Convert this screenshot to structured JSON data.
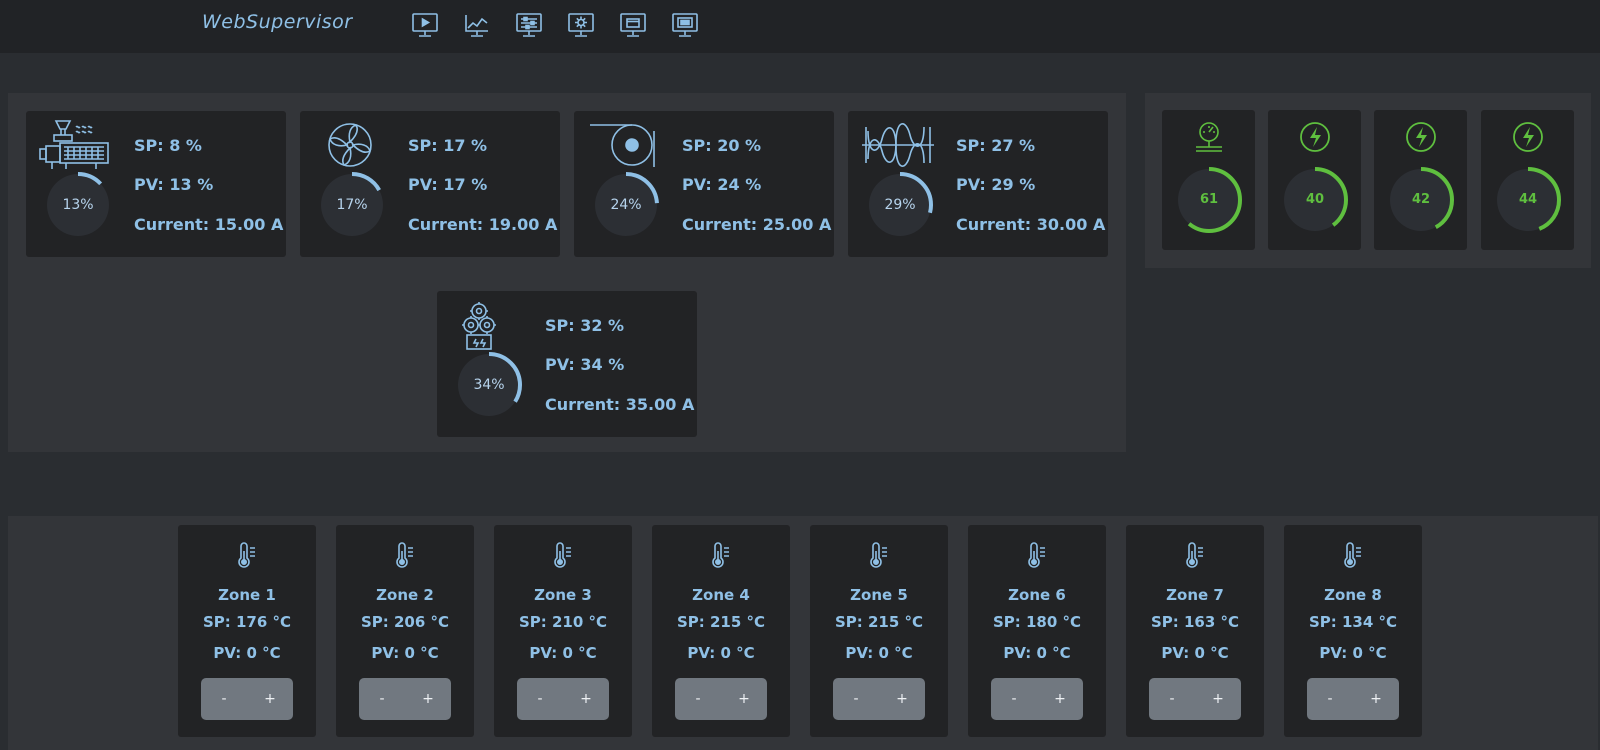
{
  "header": {
    "brand": "WebSupervisor",
    "nav_icons": [
      "monitor-play-icon",
      "monitor-chart-icon",
      "monitor-sliders-icon",
      "monitor-settings-icon",
      "monitor-window-icon",
      "monitor-screen-icon"
    ]
  },
  "motors": [
    {
      "icon": "extruder-icon",
      "sp": "SP: 8 %",
      "pv": "PV: 13 %",
      "current": "Current: 15.00 A",
      "gauge_text": "13%",
      "gauge_value": 13
    },
    {
      "icon": "fan-icon",
      "sp": "SP: 17 %",
      "pv": "PV: 17 %",
      "current": "Current: 19.00 A",
      "gauge_text": "17%",
      "gauge_value": 17
    },
    {
      "icon": "winder-icon",
      "sp": "SP: 20 %",
      "pv": "PV: 24 %",
      "current": "Current: 25.00 A",
      "gauge_text": "24%",
      "gauge_value": 24
    },
    {
      "icon": "screw-icon",
      "sp": "SP: 27 %",
      "pv": "PV: 29 %",
      "current": "Current: 30.00 A",
      "gauge_text": "29%",
      "gauge_value": 29
    },
    {
      "icon": "gearbox-icon",
      "sp": "SP: 32 %",
      "pv": "PV: 34 %",
      "current": "Current: 35.00 A",
      "gauge_text": "34%",
      "gauge_value": 34
    }
  ],
  "sensors": [
    {
      "icon": "pressure-gauge-icon",
      "value": "61",
      "gauge_value": 61
    },
    {
      "icon": "power-bolt-icon",
      "value": "40",
      "gauge_value": 40
    },
    {
      "icon": "power-bolt-icon",
      "value": "42",
      "gauge_value": 42
    },
    {
      "icon": "power-bolt-icon",
      "value": "44",
      "gauge_value": 44
    }
  ],
  "zones": [
    {
      "name": "Zone 1",
      "sp": "SP: 176 °C",
      "pv": "PV: 0 °C"
    },
    {
      "name": "Zone 2",
      "sp": "SP: 206 °C",
      "pv": "PV: 0 °C"
    },
    {
      "name": "Zone 3",
      "sp": "SP: 210 °C",
      "pv": "PV: 0 °C"
    },
    {
      "name": "Zone 4",
      "sp": "SP: 215 °C",
      "pv": "PV: 0 °C"
    },
    {
      "name": "Zone 5",
      "sp": "SP: 215 °C",
      "pv": "PV: 0 °C"
    },
    {
      "name": "Zone 6",
      "sp": "SP: 180 °C",
      "pv": "PV: 0 °C"
    },
    {
      "name": "Zone 7",
      "sp": "SP: 163 °C",
      "pv": "PV: 0 °C"
    },
    {
      "name": "Zone 8",
      "sp": "SP: 134 °C",
      "pv": "PV: 0 °C"
    }
  ],
  "zone_controls": {
    "minus": "-",
    "plus": "+"
  },
  "colors": {
    "accent_blue": "#8fc0e6",
    "accent_green": "#5fbf3f",
    "card_bg": "#222325",
    "panel_bg": "#333539"
  }
}
